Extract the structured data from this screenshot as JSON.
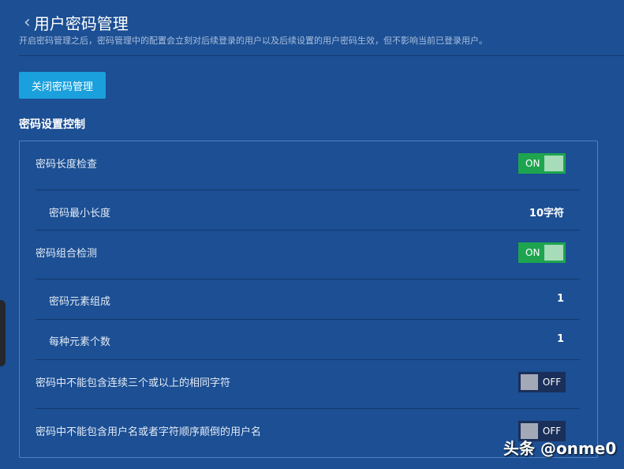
{
  "header": {
    "title": "用户密码管理",
    "description": "开启密码管理之后，密码管理中的配置会立刻对后续登录的用户以及后续设置的用户密码生效，但不影响当前已登录用户。"
  },
  "close_button": "关闭密码管理",
  "section_title": "密码设置控制",
  "rows": [
    {
      "label": "密码长度检查",
      "toggle": "ON"
    },
    {
      "label": "密码最小长度",
      "value": "10字符"
    },
    {
      "label": "密码组合检测",
      "toggle": "ON"
    },
    {
      "label": "密码元素组成",
      "value": "1"
    },
    {
      "label": "每种元素个数",
      "value": "1"
    },
    {
      "label": "密码中不能包含连续三个或以上的相同字符",
      "toggle": "OFF"
    },
    {
      "label": "密码中不能包含用户名或者字符顺序颠倒的用户名",
      "toggle": "OFF"
    }
  ],
  "watermark": "头条 @onme0"
}
